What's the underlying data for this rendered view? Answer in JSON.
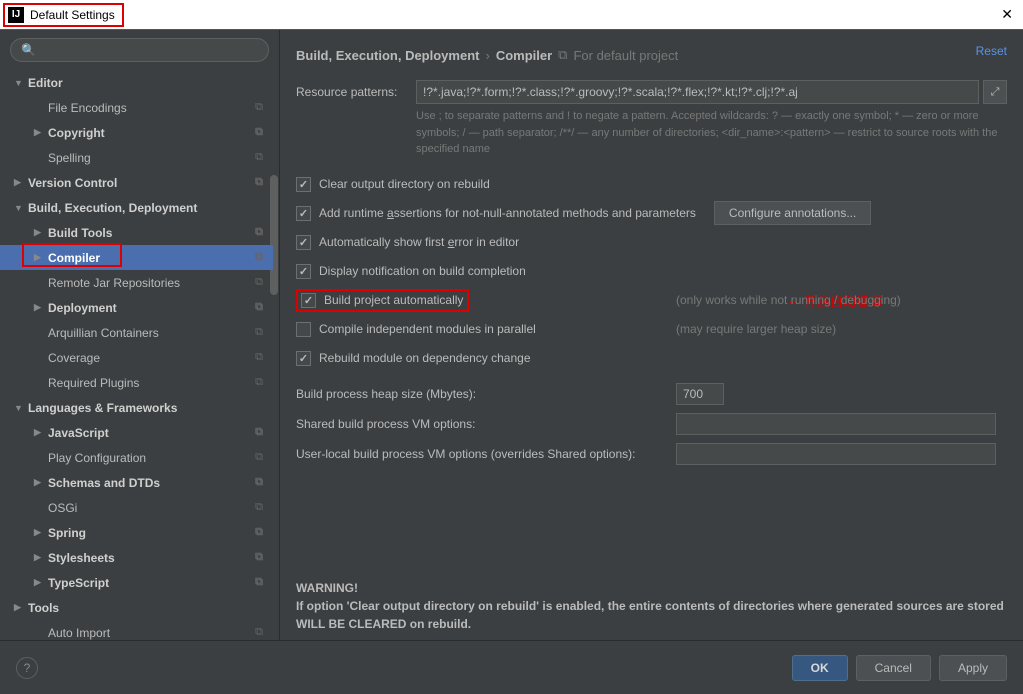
{
  "titlebar": {
    "title": "Default Settings"
  },
  "breadcrumb": {
    "c1": "Build, Execution, Deployment",
    "c2": "Compiler",
    "sub": "For default project"
  },
  "reset_label": "Reset",
  "resource": {
    "label": "Resource patterns:",
    "value": "!?*.java;!?*.form;!?*.class;!?*.groovy;!?*.scala;!?*.flex;!?*.kt;!?*.clj;!?*.aj",
    "hint": "Use ; to separate patterns and ! to negate a pattern. Accepted wildcards: ? — exactly one symbol; * — zero or more symbols; / — path separator; /**/ — any number of directories; <dir_name>:<pattern> — restrict to source roots with the specified name"
  },
  "sidebar": {
    "items": [
      {
        "label": "Editor",
        "level": "l1",
        "arrow": "down",
        "copy": false
      },
      {
        "label": "File Encodings",
        "level": "l2",
        "copy": true
      },
      {
        "label": "Copyright",
        "level": "l2b",
        "arrow": "right",
        "copy": true
      },
      {
        "label": "Spelling",
        "level": "l2",
        "copy": true
      },
      {
        "label": "Version Control",
        "level": "l1",
        "arrow": "right",
        "copy": true
      },
      {
        "label": "Build, Execution, Deployment",
        "level": "l1",
        "arrow": "down",
        "copy": false
      },
      {
        "label": "Build Tools",
        "level": "l2b",
        "arrow": "right",
        "copy": true
      },
      {
        "label": "Compiler",
        "level": "l2b",
        "arrow": "right",
        "copy": true,
        "selected": true
      },
      {
        "label": "Remote Jar Repositories",
        "level": "l2",
        "copy": true
      },
      {
        "label": "Deployment",
        "level": "l2b",
        "arrow": "right",
        "copy": true
      },
      {
        "label": "Arquillian Containers",
        "level": "l2",
        "copy": true
      },
      {
        "label": "Coverage",
        "level": "l2",
        "copy": true
      },
      {
        "label": "Required Plugins",
        "level": "l2",
        "copy": true
      },
      {
        "label": "Languages & Frameworks",
        "level": "l1",
        "arrow": "down",
        "copy": false
      },
      {
        "label": "JavaScript",
        "level": "l2b",
        "arrow": "right",
        "copy": true
      },
      {
        "label": "Play Configuration",
        "level": "l2",
        "copy": true
      },
      {
        "label": "Schemas and DTDs",
        "level": "l2b",
        "arrow": "right",
        "copy": true
      },
      {
        "label": "OSGi",
        "level": "l2",
        "copy": true
      },
      {
        "label": "Spring",
        "level": "l2b",
        "arrow": "right",
        "copy": true
      },
      {
        "label": "Stylesheets",
        "level": "l2b",
        "arrow": "right",
        "copy": true
      },
      {
        "label": "TypeScript",
        "level": "l2b",
        "arrow": "right",
        "copy": true
      },
      {
        "label": "Tools",
        "level": "l1",
        "arrow": "right",
        "copy": false
      },
      {
        "label": "Auto Import",
        "level": "l2",
        "copy": true
      }
    ]
  },
  "checks": {
    "clear": "Clear output directory on rebuild",
    "assertions_pre": "Add runtime ",
    "assertions_u": "a",
    "assertions_post": "ssertions for not-null-annotated methods and parameters",
    "cfg_btn": "Configure annotations...",
    "auto_err_pre": "Automatically show first ",
    "auto_err_u": "e",
    "auto_err_post": "rror in editor",
    "notify": "Display notification on build completion",
    "build_auto": "Build project automatically",
    "build_auto_note": "(only works while not running / debugging)",
    "annot": "开启自动编译",
    "parallel": "Compile independent modules in parallel",
    "parallel_note": "(may require larger heap size)",
    "rebuild_dep": "Rebuild module on dependency change"
  },
  "opts": {
    "heap_label": "Build process heap size (Mbytes):",
    "heap_value": "700",
    "shared_label": "Shared build process VM options:",
    "shared_value": "",
    "user_label": "User-local build process VM options (overrides Shared options):",
    "user_value": ""
  },
  "warning": {
    "title": "WARNING!",
    "body": "If option 'Clear output directory on rebuild' is enabled, the entire contents of directories where generated sources are stored WILL BE CLEARED on rebuild."
  },
  "footer": {
    "ok": "OK",
    "cancel": "Cancel",
    "apply": "Apply"
  }
}
